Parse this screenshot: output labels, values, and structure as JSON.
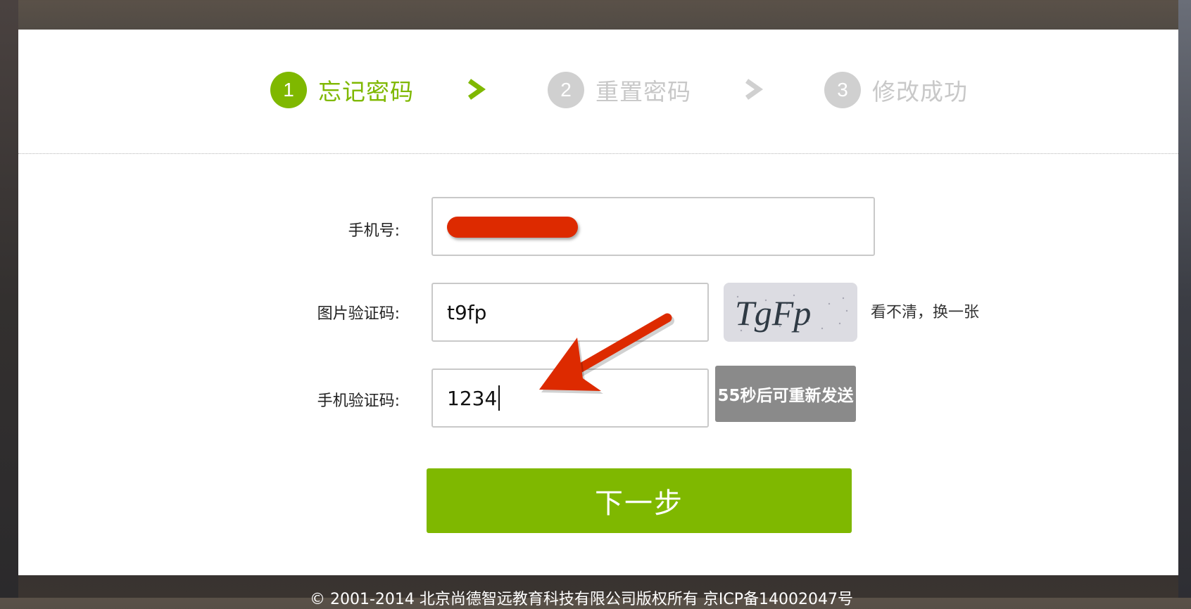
{
  "steps": [
    {
      "number": "1",
      "label": "忘记密码",
      "state": "active"
    },
    {
      "number": "2",
      "label": "重置密码",
      "state": "inactive"
    },
    {
      "number": "3",
      "label": "修改成功",
      "state": "inactive"
    }
  ],
  "form": {
    "phone_label": "手机号:",
    "image_captcha_label": "图片验证码:",
    "image_captcha_value": "t9fp",
    "captcha_image_text": "TgFp",
    "refresh_captcha_link": "看不清，换一张",
    "sms_code_label": "手机验证码:",
    "sms_code_value": "1234",
    "resend_button": "55秒后可重新发送",
    "next_button": "下一步"
  },
  "footer": {
    "copyright": "© 2001-2014 北京尚德智远教育科技有限公司版权所有 京ICP备14002047号"
  },
  "colors": {
    "accent": "#7fb800",
    "inactive_step": "#d0d0d0",
    "resend_bg": "#8a8a8a",
    "annotation": "#dd2a00"
  },
  "icons": [
    "chevron-right-icon",
    "annotation-arrow"
  ]
}
